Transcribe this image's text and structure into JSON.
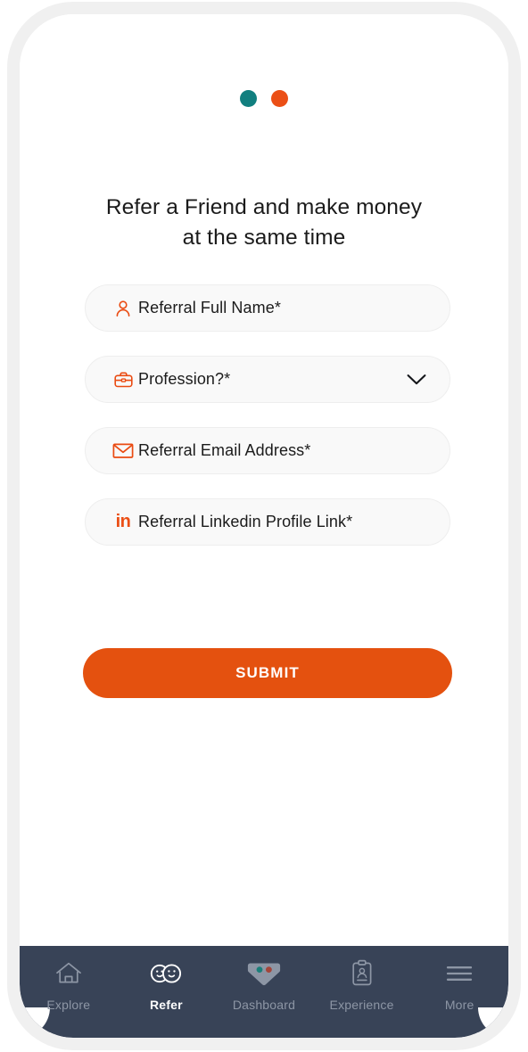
{
  "pager": {
    "dots": [
      {
        "name": "dot-teal",
        "color": "#117f7f"
      },
      {
        "name": "dot-orange",
        "color": "#eb4f16"
      }
    ]
  },
  "heading": {
    "line1": "Refer a Friend and make money",
    "line2": "at the same time"
  },
  "form": {
    "fields": [
      {
        "icon": "person-icon",
        "label": "Referral Full Name*",
        "type": "text",
        "has_chevron": false
      },
      {
        "icon": "briefcase-icon",
        "label": "Profession?*",
        "type": "select",
        "has_chevron": true
      },
      {
        "icon": "envelope-icon",
        "label": "Referral Email Address*",
        "type": "email",
        "has_chevron": false
      },
      {
        "icon": "linkedin-icon",
        "label": "Referral Linkedin Profile Link*",
        "type": "url",
        "has_chevron": false
      }
    ],
    "linkedin_glyph": "in",
    "submit_label": "SUBMIT",
    "accent_color": "#e4510f"
  },
  "bottom_nav": {
    "background_color": "#384357",
    "items": [
      {
        "icon": "home-icon",
        "label": "Explore",
        "active": false
      },
      {
        "icon": "two-faces-icon",
        "label": "Refer",
        "active": true
      },
      {
        "icon": "diamond-icon",
        "label": "Dashboard",
        "active": false
      },
      {
        "icon": "clipboard-person-icon",
        "label": "Experience",
        "active": false
      },
      {
        "icon": "hamburger-icon",
        "label": "More",
        "active": false
      }
    ]
  }
}
